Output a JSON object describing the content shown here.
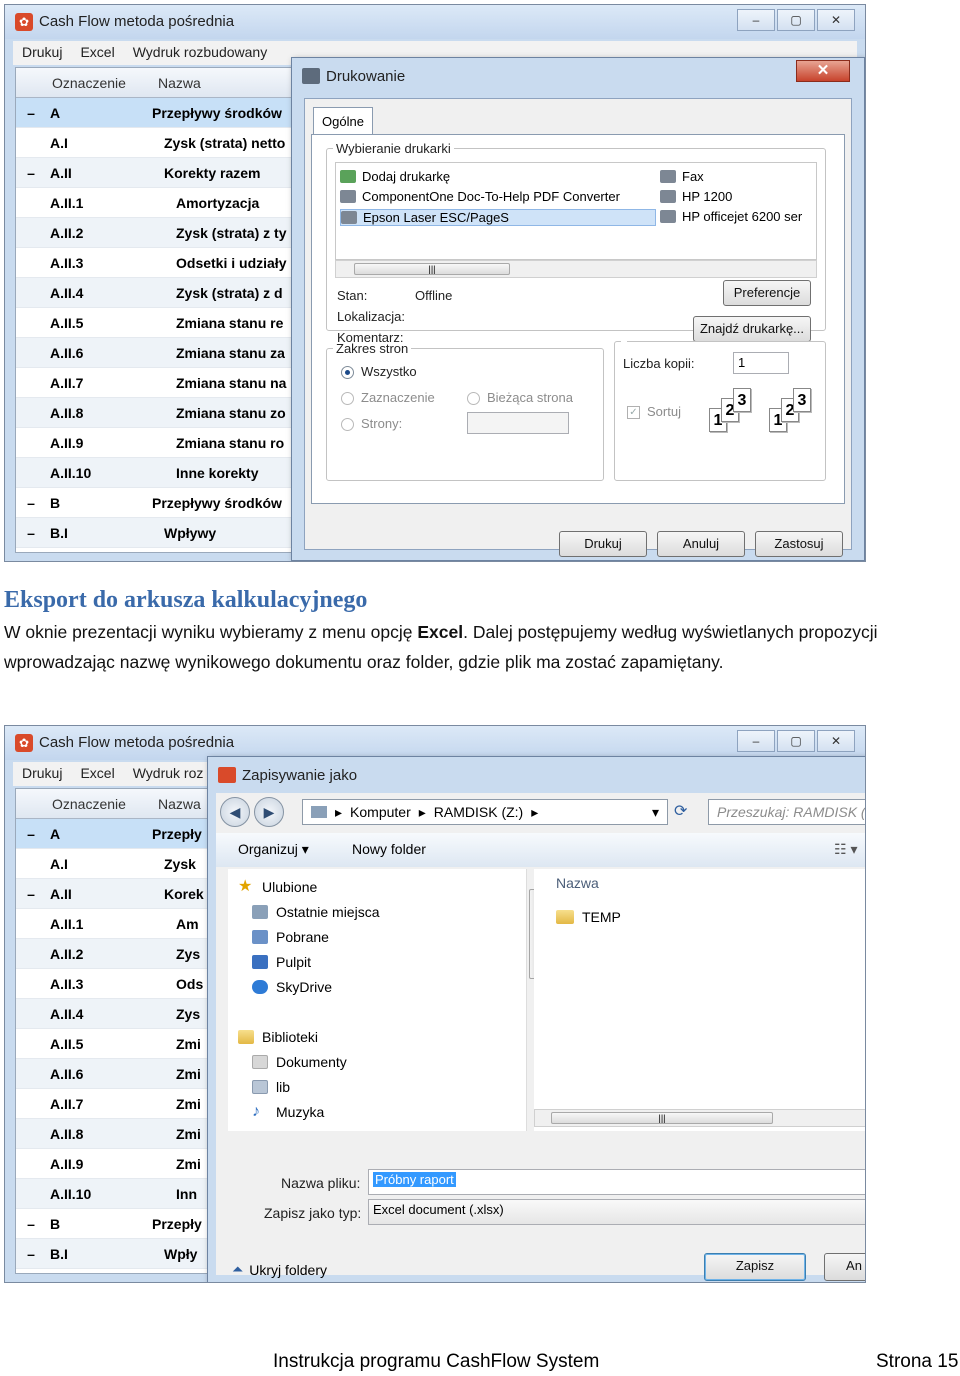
{
  "screen1": {
    "app_title": "Cash Flow metoda pośrednia",
    "menu": [
      "Drukuj",
      "Excel",
      "Wydruk rozbudowany"
    ],
    "grid_headers": {
      "code": "Oznaczenie",
      "name": "Nazwa"
    },
    "rows": [
      {
        "exp": "–",
        "code": "A",
        "name": "Przepływy środków"
      },
      {
        "exp": "",
        "code": "A.I",
        "name": "Zysk (strata) netto"
      },
      {
        "exp": "–",
        "code": "A.II",
        "name": "Korekty razem"
      },
      {
        "exp": "",
        "code": "A.II.1",
        "name": "Amortyzacja"
      },
      {
        "exp": "",
        "code": "A.II.2",
        "name": "Zysk (strata) z ty"
      },
      {
        "exp": "",
        "code": "A.II.3",
        "name": "Odsetki i udziały"
      },
      {
        "exp": "",
        "code": "A.II.4",
        "name": "Zysk (strata) z d"
      },
      {
        "exp": "",
        "code": "A.II.5",
        "name": "Zmiana stanu re"
      },
      {
        "exp": "",
        "code": "A.II.6",
        "name": "Zmiana stanu za"
      },
      {
        "exp": "",
        "code": "A.II.7",
        "name": "Zmiana stanu na"
      },
      {
        "exp": "",
        "code": "A.II.8",
        "name": "Zmiana stanu zo"
      },
      {
        "exp": "",
        "code": "A.II.9",
        "name": "Zmiana stanu ro"
      },
      {
        "exp": "",
        "code": "A.II.10",
        "name": "Inne korekty"
      },
      {
        "exp": "–",
        "code": "B",
        "name": "Przepływy środków"
      },
      {
        "exp": "–",
        "code": "B.I",
        "name": "Wpływy"
      }
    ],
    "print_dialog": {
      "title": "Drukowanie",
      "tab": "Ogólne",
      "printer_group": "Wybieranie drukarki",
      "printers_left": [
        "Dodaj drukarkę",
        "ComponentOne Doc-To-Help PDF Converter",
        "Epson Laser ESC/PageS"
      ],
      "printers_right": [
        "Fax",
        "HP 1200",
        "HP officejet 6200 ser"
      ],
      "status_label": "Stan:",
      "status_value": "Offline",
      "location_label": "Lokalizacja:",
      "comment_label": "Komentarz:",
      "preferences_button": "Preferencje",
      "find_printer_button": "Znajdź drukarkę...",
      "range_group": "Zakres stron",
      "range_all": "Wszystko",
      "range_selection": "Zaznaczenie",
      "range_current": "Bieżąca strona",
      "range_pages": "Strony:",
      "copies_label": "Liczba kopii:",
      "copies_value": "1",
      "collate_label": "Sortuj",
      "collate_pages": [
        "1",
        "2",
        "3"
      ],
      "print_button": "Drukuj",
      "cancel_button": "Anuluj",
      "apply_button": "Zastosuj"
    }
  },
  "text": {
    "heading": "Eksport do arkusza kalkulacyjnego",
    "para_start": "W oknie prezentacji wyniku wybieramy z menu opcję ",
    "para_bold": "Excel",
    "para_end": ". Dalej postępujemy według wyświetlanych propozycji wprowadzając nazwę wynikowego dokumentu oraz folder, gdzie plik ma zostać zapamiętany."
  },
  "screen2": {
    "app_title": "Cash Flow metoda pośrednia",
    "menu": [
      "Drukuj",
      "Excel",
      "Wydruk roz"
    ],
    "grid_headers": {
      "code": "Oznaczenie",
      "name": "Nazwa"
    },
    "rows": [
      {
        "exp": "–",
        "code": "A",
        "name": "Przepły"
      },
      {
        "exp": "",
        "code": "A.I",
        "name": "Zysk"
      },
      {
        "exp": "–",
        "code": "A.II",
        "name": "Korek"
      },
      {
        "exp": "",
        "code": "A.II.1",
        "name": "Am"
      },
      {
        "exp": "",
        "code": "A.II.2",
        "name": "Zys"
      },
      {
        "exp": "",
        "code": "A.II.3",
        "name": "Ods"
      },
      {
        "exp": "",
        "code": "A.II.4",
        "name": "Zys"
      },
      {
        "exp": "",
        "code": "A.II.5",
        "name": "Zmi"
      },
      {
        "exp": "",
        "code": "A.II.6",
        "name": "Zmi"
      },
      {
        "exp": "",
        "code": "A.II.7",
        "name": "Zmi"
      },
      {
        "exp": "",
        "code": "A.II.8",
        "name": "Zmi"
      },
      {
        "exp": "",
        "code": "A.II.9",
        "name": "Zmi"
      },
      {
        "exp": "",
        "code": "A.II.10",
        "name": "Inn"
      },
      {
        "exp": "–",
        "code": "B",
        "name": "Przepły"
      },
      {
        "exp": "–",
        "code": "B.I",
        "name": "Wpły"
      }
    ],
    "save_dialog": {
      "title": "Zapisywanie jako",
      "breadcrumb": [
        "Komputer",
        "RAMDISK (Z:)"
      ],
      "search_placeholder": "Przeszukaj: RAMDISK (Z:)",
      "organize": "Organizuj",
      "new_folder": "Nowy folder",
      "favorites": "Ulubione",
      "fav_items": [
        "Ostatnie miejsca",
        "Pobrane",
        "Pulpit",
        "SkyDrive"
      ],
      "libraries": "Biblioteki",
      "lib_items": [
        "Dokumenty",
        "lib",
        "Muzyka"
      ],
      "col_name": "Nazwa",
      "col_trunc": "D",
      "files": [
        "TEMP"
      ],
      "filename_label": "Nazwa pliku:",
      "filename_value": "Próbny raport",
      "type_label": "Zapisz jako typ:",
      "type_value": "Excel document  (.xlsx)",
      "hide_folders": "Ukryj foldery",
      "save_button": "Zapisz",
      "cancel_button": "An"
    }
  },
  "footer": {
    "left": "Instrukcja programu CashFlow System",
    "right": "Strona 15"
  },
  "colors": {
    "heading": "#3a6aaa",
    "selection": "#3399ff",
    "window_frame": "#c9dbef"
  }
}
